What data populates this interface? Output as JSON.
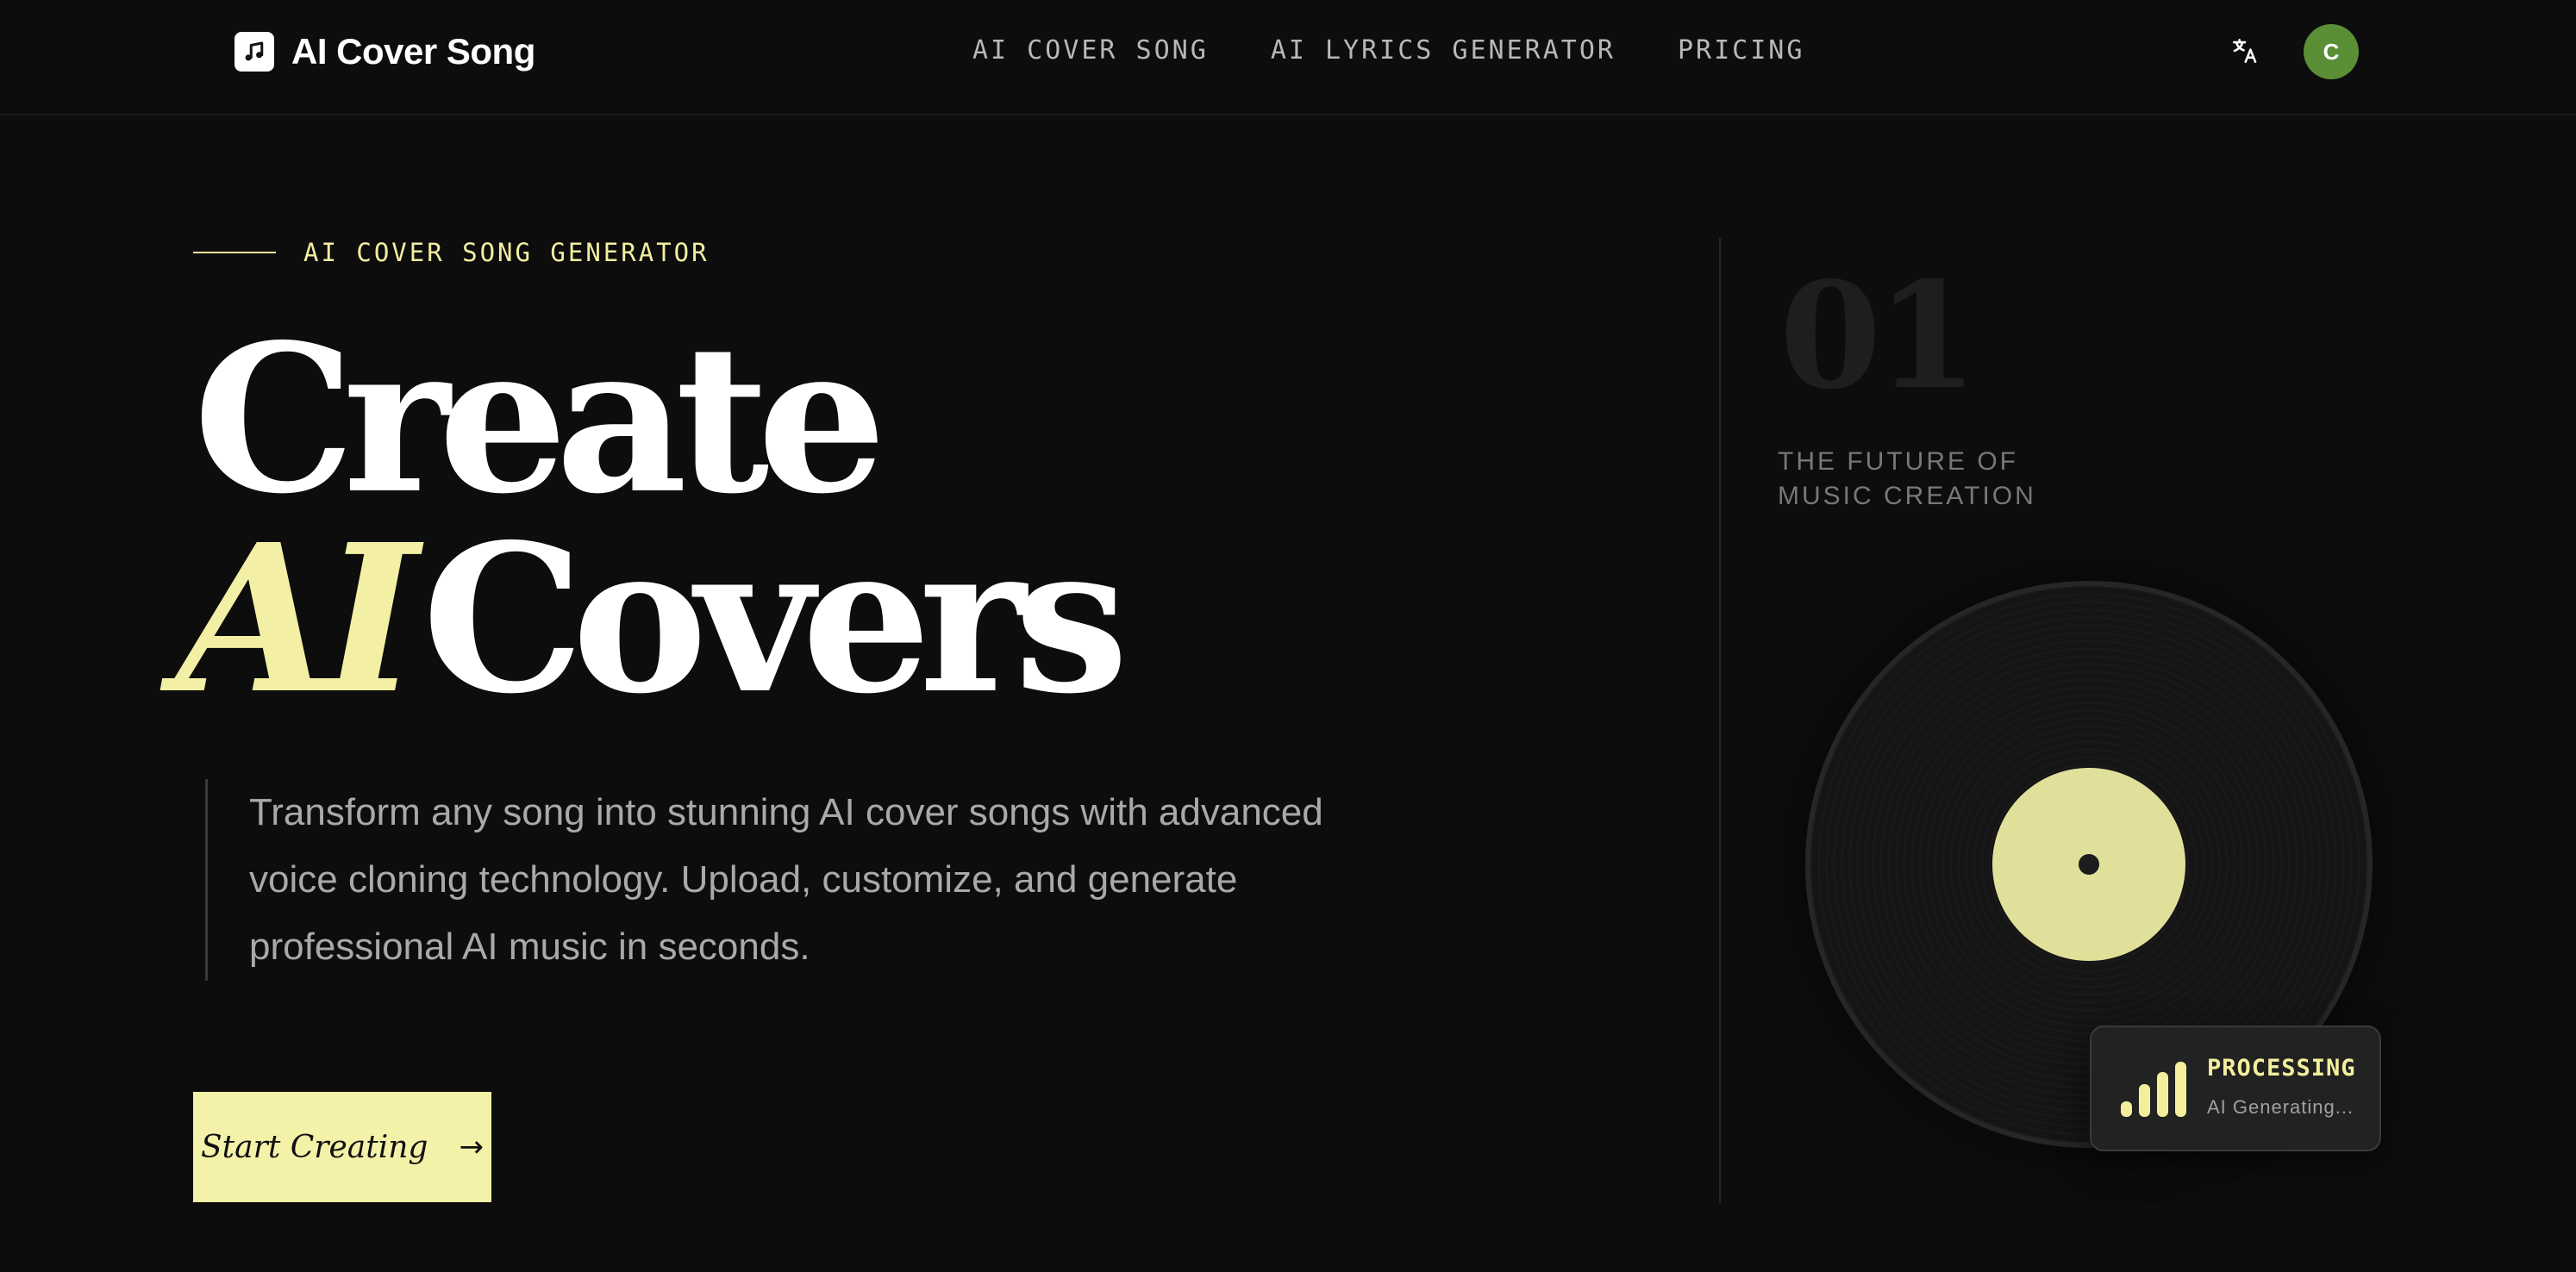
{
  "header": {
    "brand_name": "AI Cover Song",
    "nav": [
      {
        "label": "AI COVER SONG"
      },
      {
        "label": "AI LYRICS GENERATOR"
      },
      {
        "label": "PRICING"
      }
    ],
    "translate_icon": "translate-icon",
    "avatar_initial": "C",
    "avatar_color": "#5a8f35"
  },
  "hero": {
    "eyebrow": "AI COVER SONG GENERATOR",
    "headline_line1": "Create",
    "headline_accent": "AI",
    "headline_line2_rest": "Covers",
    "description": "Transform any song into stunning AI cover songs with advanced voice cloning technology. Upload, customize, and generate professional AI music in seconds.",
    "cta_label": "Start Creating",
    "cta_icon": "arrow-right-icon",
    "accent_color": "#f4f1a8"
  },
  "side": {
    "number": "01",
    "tagline_line1": "THE FUTURE OF",
    "tagline_line2": "MUSIC CREATION",
    "record_icon": "vinyl-record-icon",
    "status": {
      "title": "PROCESSING",
      "subtitle": "AI Generating...",
      "icon": "signal-bars-icon"
    }
  }
}
